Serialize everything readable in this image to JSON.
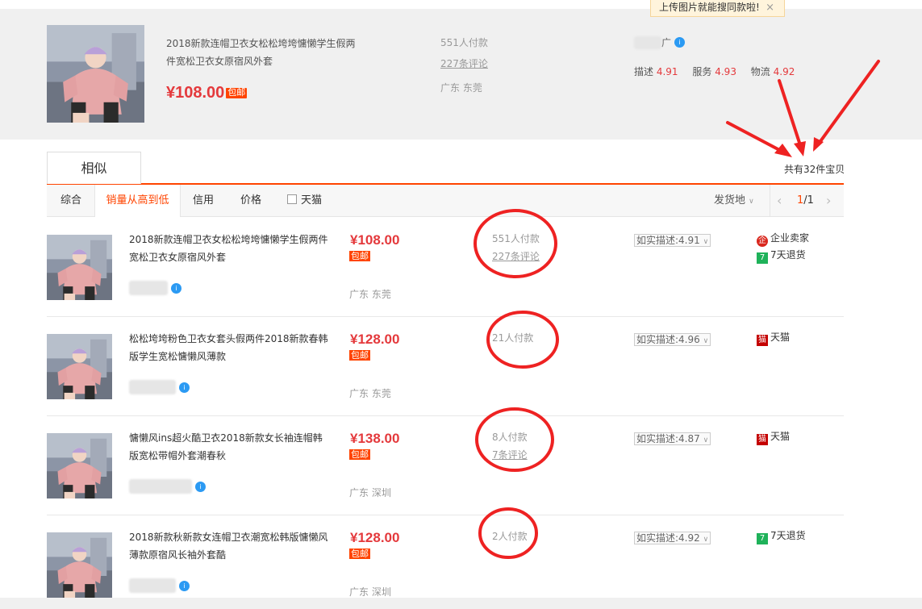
{
  "banner": {
    "tip": "上传图片就能搜同款啦!",
    "tip_close": "×",
    "title": "2018新款连帽卫衣女松松垮垮慵懒学生假两件宽松卫衣女原宿风外套",
    "price": "¥108.00",
    "baoyou": "包邮",
    "pay": "551人付款",
    "reviews": "227条评论",
    "location": "广东 东莞",
    "shop_tail": "广",
    "scores": [
      {
        "label": "描述",
        "value": "4.91"
      },
      {
        "label": "服务",
        "value": "4.93"
      },
      {
        "label": "物流",
        "value": "4.92"
      }
    ]
  },
  "tab": {
    "label": "相似"
  },
  "total": "共有32件宝贝",
  "filters": {
    "items": [
      "综合",
      "销量从高到低",
      "信用",
      "价格"
    ],
    "tmall": "天猫",
    "shipfrom": "发货地",
    "page": "1",
    "page_total": "/1"
  },
  "icons": {
    "arrow_prev": "‹",
    "arrow_next": "›",
    "chevron": "∨",
    "ww": "i"
  },
  "colors": {
    "accent": "#ff4400",
    "price": "#e4393c",
    "annotation": "#ee2222"
  },
  "items": [
    {
      "title": "2018新款连帽卫衣女松松垮垮慵懒学生假两件宽松卫衣女原宿风外套",
      "price": "¥108.00",
      "baoyou": "包邮",
      "location": "广东 东莞",
      "pay": "551人付款",
      "reviews": "227条评论",
      "desc": "如实描述:4.91",
      "badges": [
        {
          "type": "enterprise",
          "label": "企业卖家"
        },
        {
          "type": "return7",
          "label": "7天退货"
        }
      ]
    },
    {
      "title": "松松垮垮粉色卫衣女套头假两件2018新款春韩版学生宽松慵懒风薄款",
      "price": "¥128.00",
      "baoyou": "包邮",
      "location": "广东 东莞",
      "pay": "21人付款",
      "reviews": "",
      "desc": "如实描述:4.96",
      "badges": [
        {
          "type": "tmall",
          "label": "天猫"
        }
      ]
    },
    {
      "title": "慵懒风ins超火酷卫衣2018新款女长袖连帽韩版宽松带帽外套潮春秋",
      "price": "¥138.00",
      "baoyou": "包邮",
      "location": "广东 深圳",
      "pay": "8人付款",
      "reviews": "7条评论",
      "desc": "如实描述:4.87",
      "badges": [
        {
          "type": "tmall",
          "label": "天猫"
        }
      ]
    },
    {
      "title": "2018新款秋新款女连帽卫衣潮宽松韩版慵懒风薄款原宿风长袖外套酷",
      "price": "¥128.00",
      "baoyou": "包邮",
      "location": "广东 深圳",
      "pay": "2人付款",
      "reviews": "",
      "desc": "如实描述:4.92",
      "badges": [
        {
          "type": "return7",
          "label": "7天退货"
        }
      ]
    }
  ]
}
